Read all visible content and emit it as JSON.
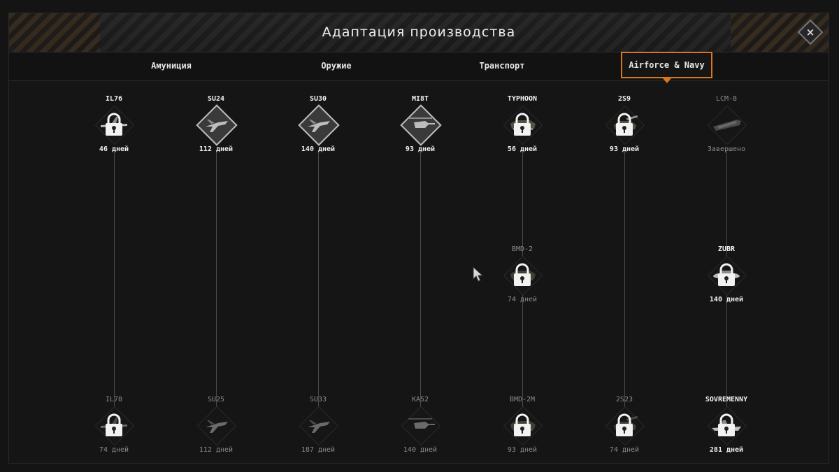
{
  "window": {
    "title": "Адаптация производства",
    "close_label": "×"
  },
  "tabs": [
    {
      "label": "Амуниция",
      "active": false
    },
    {
      "label": "Оружие",
      "active": false
    },
    {
      "label": "Транспорт",
      "active": false
    },
    {
      "label": "Airforce & Navy",
      "active": true
    }
  ],
  "colors": {
    "accent": "#d9771c",
    "text": "#efefef",
    "dim_text": "#8c8c8c",
    "background": "#151515"
  },
  "tree": {
    "columns": [
      {
        "nodes": [
          {
            "name": "IL76",
            "time": "46 дней",
            "state": "locked",
            "icon": "transport-plane-icon"
          },
          {
            "name": "IL78",
            "time": "74 дней",
            "state": "locked-dim",
            "icon": "transport-plane-icon"
          }
        ]
      },
      {
        "nodes": [
          {
            "name": "SU24",
            "time": "112 дней",
            "state": "unlocked",
            "icon": "jet-icon"
          },
          {
            "name": "SU25",
            "time": "112 дней",
            "state": "dim",
            "icon": "jet-icon"
          }
        ]
      },
      {
        "nodes": [
          {
            "name": "SU30",
            "time": "140 дней",
            "state": "unlocked",
            "icon": "jet-icon"
          },
          {
            "name": "SU33",
            "time": "187 дней",
            "state": "dim",
            "icon": "jet-icon"
          }
        ]
      },
      {
        "nodes": [
          {
            "name": "MI8T",
            "time": "93 дней",
            "state": "unlocked",
            "icon": "helicopter-icon"
          },
          {
            "name": "KA52",
            "time": "140 дней",
            "state": "dim",
            "icon": "helicopter-icon"
          }
        ]
      },
      {
        "nodes": [
          {
            "name": "TYPHOON",
            "time": "56 дней",
            "state": "locked",
            "icon": "armored-vehicle-icon"
          },
          {
            "name": "BMD-2",
            "time": "74 дней",
            "state": "locked-dim",
            "icon": "armored-vehicle-icon"
          },
          {
            "name": "BMD-2M",
            "time": "93 дней",
            "state": "locked-dim",
            "icon": "armored-vehicle-icon"
          }
        ]
      },
      {
        "nodes": [
          {
            "name": "2S9",
            "time": "93 дней",
            "state": "locked",
            "icon": "artillery-icon"
          },
          {
            "name": "2S23",
            "time": "74 дней",
            "state": "locked-dim",
            "icon": "artillery-icon"
          }
        ]
      },
      {
        "nodes": [
          {
            "name": "LCM-8",
            "time": "Завершено",
            "state": "dim",
            "icon": "landing-craft-icon"
          },
          {
            "name": "ZUBR",
            "time": "140 дней",
            "state": "locked",
            "icon": "hovercraft-icon"
          },
          {
            "name": "SOVREMENNY",
            "time": "281 дней",
            "state": "locked",
            "icon": "destroyer-icon"
          }
        ]
      }
    ]
  }
}
